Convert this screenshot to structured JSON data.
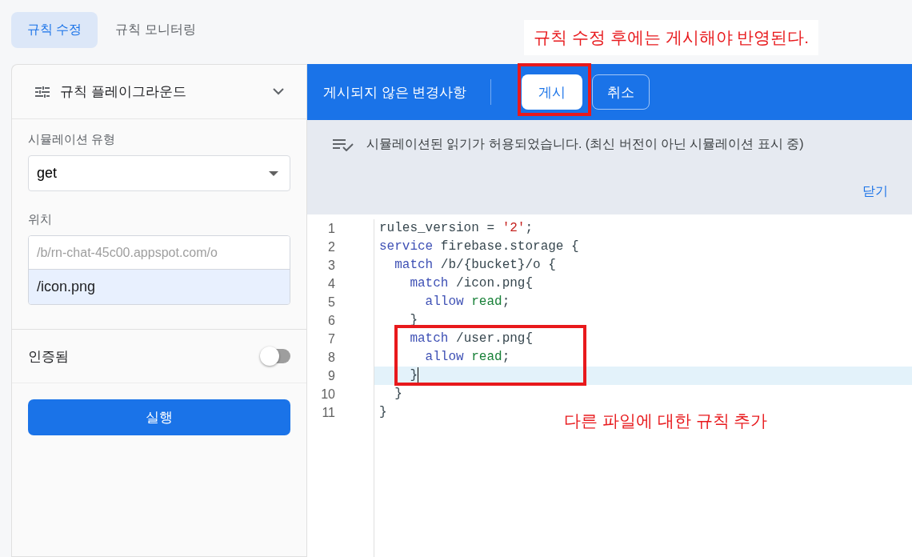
{
  "tabs": [
    {
      "label": "규칙 수정",
      "selected": true
    },
    {
      "label": "규칙 모니터링",
      "selected": false
    }
  ],
  "playground": {
    "title": "규칙 플레이그라운드",
    "expanded": false,
    "simulation_type_label": "시뮬레이션 유형",
    "simulation_type": "get",
    "location_label": "위치",
    "location_prefix": "/b/rn-chat-45c00.appspot.com/o",
    "location_value": "/icon.png",
    "auth_label": "인증됨",
    "auth_on": false,
    "run_button": "실행"
  },
  "publish_bar": {
    "status": "게시되지 않은 변경사항",
    "publish_button": "게시",
    "cancel_button": "취소"
  },
  "notice": {
    "message": "시뮬레이션된 읽기가 허용되었습니다. (최신 버전이 아닌 시뮬레이션 표시 중)",
    "close": "닫기"
  },
  "editor": {
    "lines": [
      {
        "number": "1",
        "active": false,
        "tokens": [
          {
            "text": "rules_version = ",
            "kind": "plain"
          },
          {
            "text": "'2'",
            "kind": "string"
          },
          {
            "text": ";",
            "kind": "plain"
          }
        ]
      },
      {
        "number": "2",
        "active": false,
        "tokens": [
          {
            "text": "service",
            "kind": "keyword"
          },
          {
            "text": " firebase.storage {",
            "kind": "plain"
          }
        ]
      },
      {
        "number": "3",
        "active": false,
        "tokens": [
          {
            "text": "  match",
            "kind": "keyword"
          },
          {
            "text": " /b/{bucket}/o {",
            "kind": "plain"
          }
        ]
      },
      {
        "number": "4",
        "active": false,
        "tokens": [
          {
            "text": "    match",
            "kind": "keyword"
          },
          {
            "text": " /icon.png{",
            "kind": "plain"
          }
        ]
      },
      {
        "number": "5",
        "active": false,
        "tokens": [
          {
            "text": "      allow ",
            "kind": "keyword"
          },
          {
            "text": "read",
            "kind": "permission"
          },
          {
            "text": ";",
            "kind": "plain"
          }
        ]
      },
      {
        "number": "6",
        "active": false,
        "tokens": [
          {
            "text": "    }",
            "kind": "plain"
          }
        ]
      },
      {
        "number": "7",
        "active": false,
        "tokens": [
          {
            "text": "    match",
            "kind": "keyword"
          },
          {
            "text": " /user.png{",
            "kind": "plain"
          }
        ]
      },
      {
        "number": "8",
        "active": false,
        "tokens": [
          {
            "text": "      allow ",
            "kind": "keyword"
          },
          {
            "text": "read",
            "kind": "permission"
          },
          {
            "text": ";",
            "kind": "plain"
          }
        ]
      },
      {
        "number": "9",
        "active": true,
        "tokens": [
          {
            "text": "    }",
            "kind": "plain"
          }
        ]
      },
      {
        "number": "10",
        "active": false,
        "tokens": [
          {
            "text": "  }",
            "kind": "plain"
          }
        ]
      },
      {
        "number": "11",
        "active": false,
        "tokens": [
          {
            "text": "}",
            "kind": "plain"
          }
        ]
      }
    ]
  },
  "annotations": [
    {
      "kind": "publish-note",
      "text": "규칙 수정 후에는 게시해야 반영된다."
    },
    {
      "kind": "code-note",
      "text": "다른 파일에 대한 규칙 추가"
    }
  ]
}
